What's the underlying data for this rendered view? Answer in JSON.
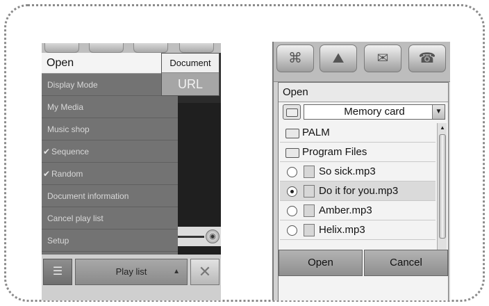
{
  "left_screen": {
    "menu": {
      "open_label": "Open",
      "items": [
        {
          "label": "Display Mode",
          "checked": false
        },
        {
          "label": "My Media",
          "checked": false
        },
        {
          "label": "Music shop",
          "checked": false
        },
        {
          "label": "Sequence",
          "checked": true
        },
        {
          "label": "Random",
          "checked": true
        },
        {
          "label": "Document information",
          "checked": false
        },
        {
          "label": "Cancel play list",
          "checked": false
        },
        {
          "label": "Setup",
          "checked": false
        }
      ],
      "check_glyph": "✔"
    },
    "submenu": {
      "document_label": "Document",
      "url_label": "URL"
    },
    "bottom_bar": {
      "playlist_label": "Play list",
      "menu_icon": "☰",
      "close_icon": "✕",
      "up_icon": "▲"
    },
    "volume_icon": "◉"
  },
  "right_screen": {
    "toolbar": {
      "icons": [
        "⌘",
        "⛰",
        "✉",
        "☎"
      ]
    },
    "dialog": {
      "title": "Open",
      "location": "Memory card",
      "dropdown_arrow": "▼",
      "folders": [
        "PALM",
        "Program Files"
      ],
      "files": [
        {
          "name": "So sick.mp3",
          "selected": false
        },
        {
          "name": "Do it for you.mp3",
          "selected": true
        },
        {
          "name": "Amber.mp3",
          "selected": false
        },
        {
          "name": "Helix.mp3",
          "selected": false
        }
      ],
      "open_button": "Open",
      "cancel_button": "Cancel"
    }
  }
}
